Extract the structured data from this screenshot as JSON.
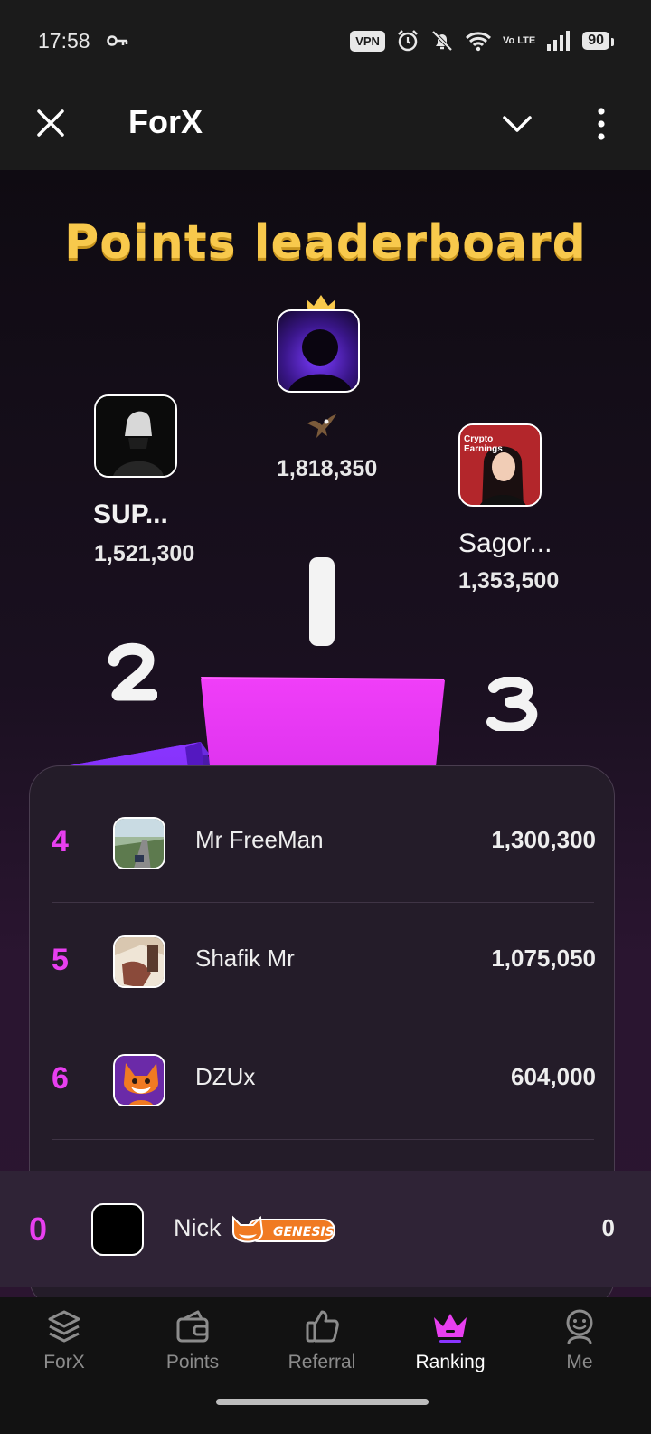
{
  "status_bar": {
    "time": "17:58",
    "vpn": "VPN",
    "volte": "Vo LTE",
    "battery": "90",
    "icons": [
      "key-icon",
      "alarm-icon",
      "bell-off-icon",
      "wifi-icon",
      "signal-icon",
      "battery-icon"
    ]
  },
  "app_bar": {
    "title": "ForX",
    "close_icon": "close-icon",
    "collapse_icon": "chevron-down-icon",
    "menu_icon": "more-vert-icon"
  },
  "leaderboard": {
    "title": "Points leaderboard",
    "podium": [
      {
        "rank": "1",
        "name": "",
        "points": "1,818,350",
        "badge_icon": "eagle-icon"
      },
      {
        "rank": "2",
        "name": "SUP...",
        "points": "1,521,300"
      },
      {
        "rank": "3",
        "name": "Sagor...",
        "points": "1,353,500",
        "avatar_text": "Crypto Earnings"
      }
    ],
    "list": [
      {
        "rank": "4",
        "name": "Mr FreeMan",
        "points": "1,300,300"
      },
      {
        "rank": "5",
        "name": "Shafik Mr",
        "points": "1,075,050"
      },
      {
        "rank": "6",
        "name": "DZUx",
        "points": "604,000"
      }
    ],
    "me": {
      "rank": "0",
      "name": "Nick",
      "badge": "GENESIS",
      "points": "0"
    }
  },
  "nav": {
    "items": [
      {
        "label": "ForX",
        "icon": "layers-icon"
      },
      {
        "label": "Points",
        "icon": "wallet-icon"
      },
      {
        "label": "Referral",
        "icon": "thumbs-up-icon"
      },
      {
        "label": "Ranking",
        "icon": "crown-icon"
      },
      {
        "label": "Me",
        "icon": "profile-icon"
      }
    ],
    "active": "Ranking"
  },
  "colors": {
    "accent": "#e83ff0",
    "title_yellow": "#f8c94c",
    "podium_purple": "#7b2fff",
    "podium_magenta": "#e030f5"
  }
}
